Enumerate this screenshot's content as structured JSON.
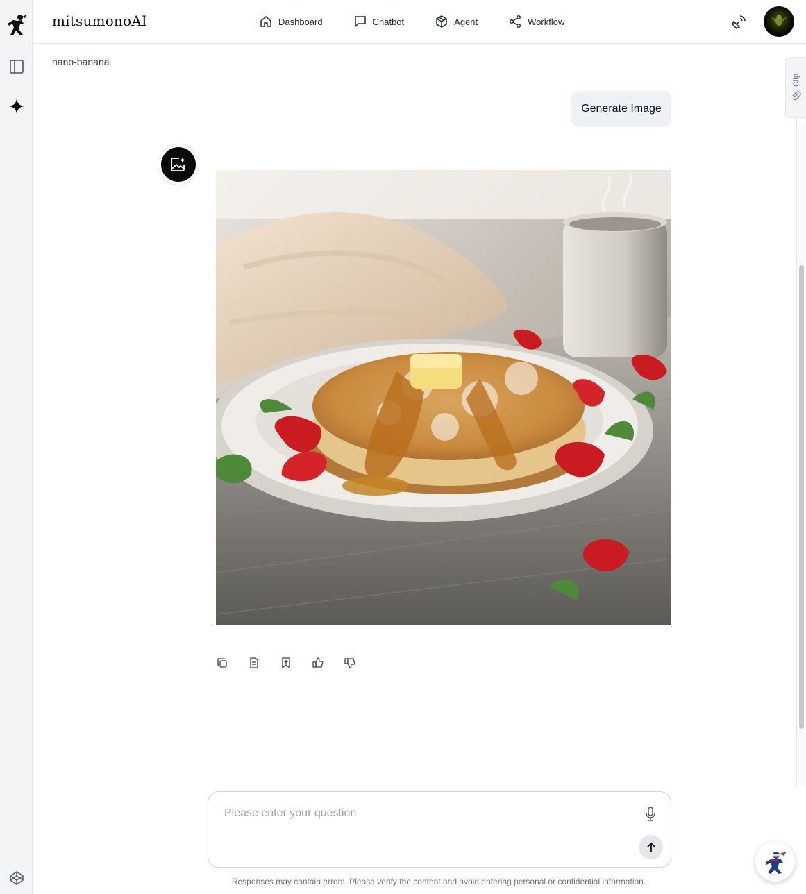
{
  "app": {
    "brand": "mitsumonoAI"
  },
  "nav": {
    "items": [
      {
        "label": "Dashboard",
        "icon": "home-icon"
      },
      {
        "label": "Chatbot",
        "icon": "chat-bubble-icon"
      },
      {
        "label": "Agent",
        "icon": "cube-icon"
      },
      {
        "label": "Workflow",
        "icon": "share-nodes-icon"
      }
    ]
  },
  "sidebar": {
    "icons": [
      "ninja-logo-icon",
      "panel-toggle-icon",
      "sparkle-icon",
      "codepen-icon"
    ]
  },
  "model": {
    "name": "nano-banana"
  },
  "clip": {
    "label": "Clip"
  },
  "chat": {
    "user_message": "Generate Image",
    "assistant_image": "pancake stack with butter, syrup, powdered sugar and strawberries on a plate beside a steaming mug",
    "actions": [
      "copy-icon",
      "document-icon",
      "bookmark-icon",
      "thumbs-up-icon",
      "thumbs-down-icon"
    ]
  },
  "input": {
    "placeholder": "Please enter your question",
    "value": ""
  },
  "disclaimer": "Responses may contain errors. Please verify the content and avoid entering personal or confidential information.",
  "colors": {
    "accent": "#111111",
    "rail_bg": "#f3f4f6",
    "bubble_bg": "#eef1f6"
  }
}
